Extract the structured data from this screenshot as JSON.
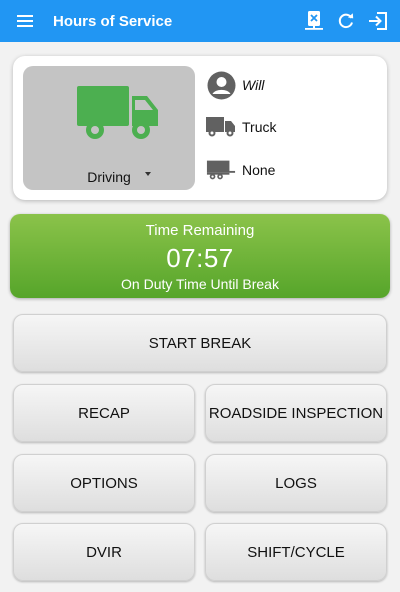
{
  "appbar": {
    "title": "Hours of Service",
    "icons": [
      "menu-icon",
      "remove-device-icon",
      "refresh-icon",
      "logout-icon"
    ]
  },
  "status": {
    "current": "Driving",
    "color": "#4caf50"
  },
  "driver": {
    "name": "Will"
  },
  "vehicle": {
    "name": "Truck"
  },
  "trailer": {
    "name": "None"
  },
  "time_remaining": {
    "label": "Time Remaining",
    "value": "07:57",
    "description": "On Duty Time Until Break"
  },
  "buttons": {
    "start_break": "START BREAK",
    "recap": "RECAP",
    "roadside_inspection": "ROADSIDE INSPECTION",
    "options": "OPTIONS",
    "logs": "LOGS",
    "dvir": "DVIR",
    "shift_cycle": "SHIFT/CYCLE"
  },
  "colors": {
    "appbar": "#2196f3",
    "time_box_top": "#8bc34a",
    "time_box_bottom": "#56a52a"
  }
}
